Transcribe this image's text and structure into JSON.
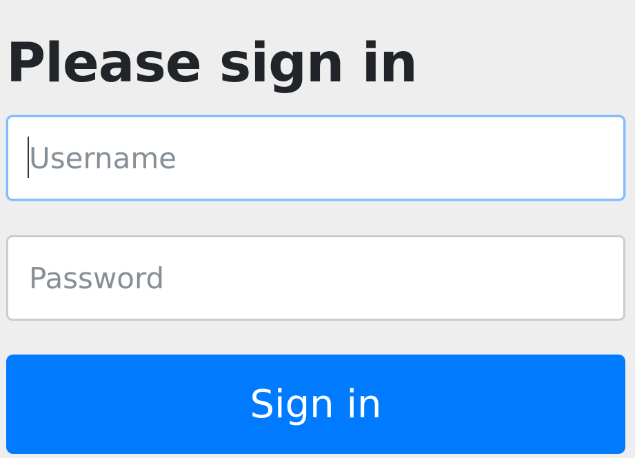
{
  "form": {
    "heading": "Please sign in",
    "username": {
      "value": "",
      "placeholder": "Username",
      "focused": true
    },
    "password": {
      "value": "",
      "placeholder": "Password"
    },
    "submit_label": "Sign in"
  },
  "colors": {
    "background": "#eeeeee",
    "heading_text": "#212529",
    "placeholder_text": "#868e96",
    "focus_border": "#80bdff",
    "input_border": "#cccccc",
    "button_background": "#007bff",
    "button_text": "#ffffff"
  }
}
